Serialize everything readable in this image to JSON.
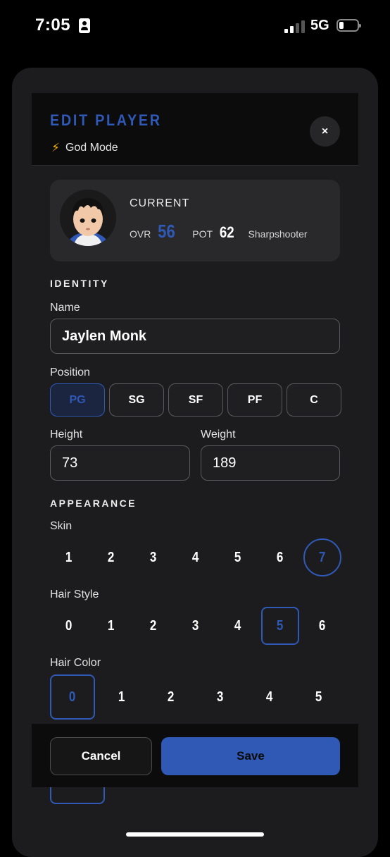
{
  "status": {
    "time": "7:05",
    "network": "5G"
  },
  "header": {
    "title": "EDIT PLAYER",
    "mode_icon": "⚡",
    "mode": "God Mode",
    "close": "×"
  },
  "current": {
    "label": "CURRENT",
    "ovr_label": "OVR",
    "ovr": "56",
    "pot_label": "POT",
    "pot": "62",
    "archetype": "Sharpshooter"
  },
  "identity": {
    "section": "IDENTITY",
    "name_label": "Name",
    "name_value": "Jaylen Monk",
    "position_label": "Position",
    "positions": [
      "PG",
      "SG",
      "SF",
      "PF",
      "C"
    ],
    "selected_position": "PG",
    "height_label": "Height",
    "height_value": "73",
    "weight_label": "Weight",
    "weight_value": "189"
  },
  "appearance": {
    "section": "APPEARANCE",
    "skin_label": "Skin",
    "skin_options": [
      "1",
      "2",
      "3",
      "4",
      "5",
      "6",
      "7"
    ],
    "skin_selected": "7",
    "hair_style_label": "Hair Style",
    "hair_style_options": [
      "0",
      "1",
      "2",
      "3",
      "4",
      "5",
      "6"
    ],
    "hair_style_selected": "5",
    "hair_color_label": "Hair Color",
    "hair_color_options": [
      "0",
      "1",
      "2",
      "3",
      "4",
      "5"
    ],
    "hair_color_selected": "0"
  },
  "footer": {
    "cancel": "Cancel",
    "save": "Save"
  },
  "colors": {
    "accent": "#2f59b5",
    "bolt": "#f5b301",
    "sheet": "#1c1c1e"
  },
  "icons": {
    "close": "close-icon",
    "bolt": "lightning-icon",
    "avatar": "player-avatar"
  }
}
